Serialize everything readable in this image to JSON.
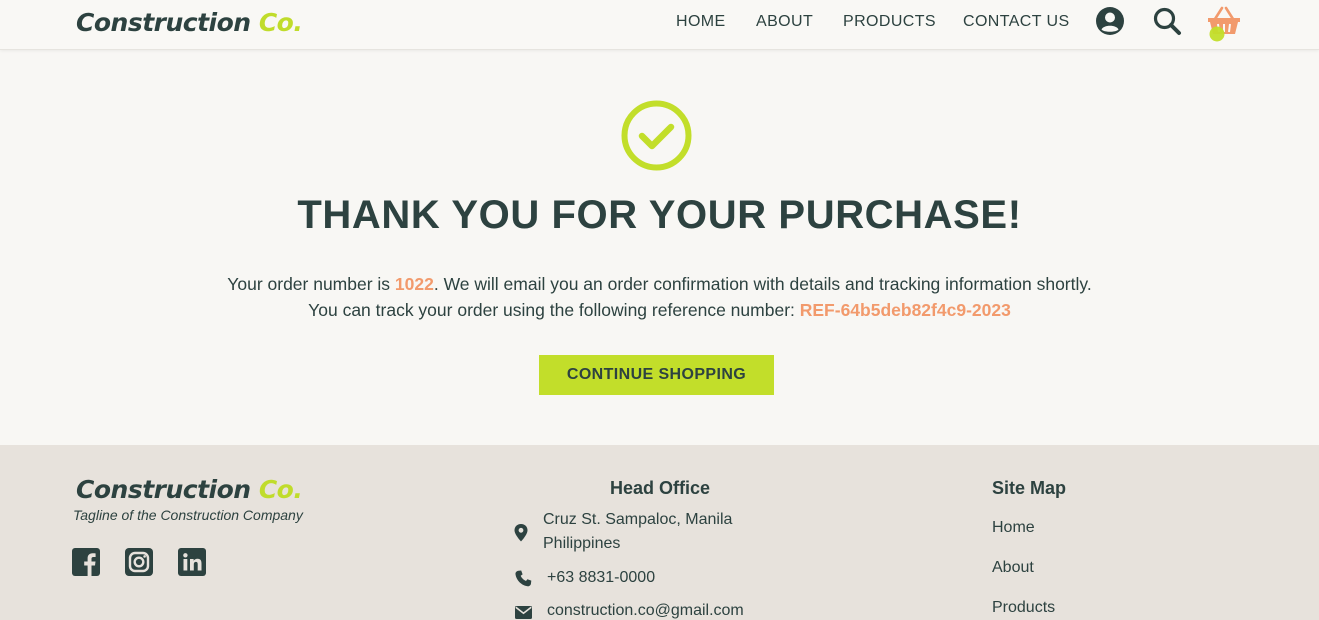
{
  "brand": {
    "name_main": "Construction",
    "name_accent": "Co.",
    "tagline": "Tagline of the Construction Company"
  },
  "nav": [
    {
      "label": "HOME"
    },
    {
      "label": "ABOUT"
    },
    {
      "label": "PRODUCTS"
    },
    {
      "label": "CONTACT US"
    }
  ],
  "header_icons": [
    "user-icon",
    "search-icon",
    "basket-icon"
  ],
  "main": {
    "title": "THANK YOU FOR YOUR PURCHASE!",
    "line1_prefix": "Your order number is ",
    "order_number": "1022",
    "line1_suffix": ". We will email you an order confirmation with details and tracking information shortly.",
    "line2_prefix": "You can track your order using the following reference number: ",
    "reference": "REF-64b5deb82f4c9-2023",
    "cta_label": "CONTINUE SHOPPING"
  },
  "footer": {
    "social": [
      "facebook-icon",
      "instagram-icon",
      "linkedin-icon"
    ],
    "head_office_title": "Head Office",
    "address_line1": "Cruz St. Sampaloc, Manila",
    "address_line2": "Philippines",
    "phone": "+63 8831-0000",
    "email": "construction.co@gmail.com",
    "sitemap_title": "Site Map",
    "sitemap": [
      {
        "label": "Home"
      },
      {
        "label": "About"
      },
      {
        "label": "Products"
      }
    ]
  },
  "colors": {
    "primary": "#2d4240",
    "accent": "#c2de2a",
    "highlight": "#f29a6c",
    "footer_bg": "#e7e2dc",
    "page_bg": "#f8f7f4"
  }
}
